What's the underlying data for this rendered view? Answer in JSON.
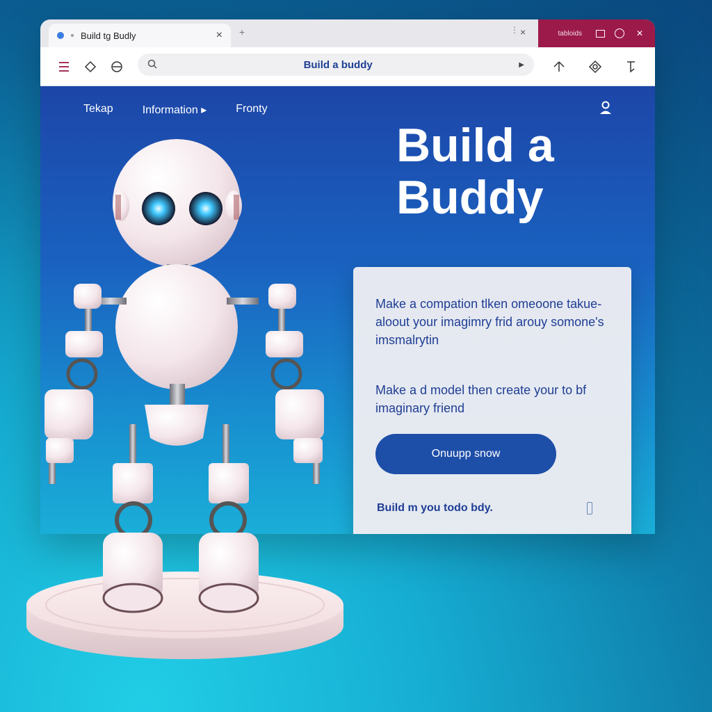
{
  "browser": {
    "tab_title": "Build tg Budly",
    "tab_close": "×",
    "new_tab": "+",
    "tabbar_close": "×",
    "tabbar_dots": "⋮",
    "window_title": "tabloids",
    "address_text": "Build a buddy"
  },
  "nav": {
    "items": [
      "Tekap",
      "Information ▸",
      "Fronty"
    ]
  },
  "hero": {
    "title_line1": "Build a",
    "title_line2": "Buddy"
  },
  "card": {
    "paragraph1": "Make a compation tlken omeoone takue-aloout your imagimry frid arouy somone's imsmalrytin",
    "paragraph2": "Make a d model then create your to bf imaginary friend",
    "cta_label": "Onuupp snow",
    "footer_text": "Build m you todo bdy."
  },
  "colors": {
    "accent": "#1d4ea8",
    "window_controls": "#9c1a4a",
    "page_top": "#1c46a8",
    "page_bottom": "#1aaed8"
  },
  "icons": [
    "menu-icon",
    "extension-icon",
    "reload-icon",
    "search-icon",
    "go-icon",
    "share-icon",
    "settings-icon",
    "cursor-icon",
    "user-icon"
  ]
}
